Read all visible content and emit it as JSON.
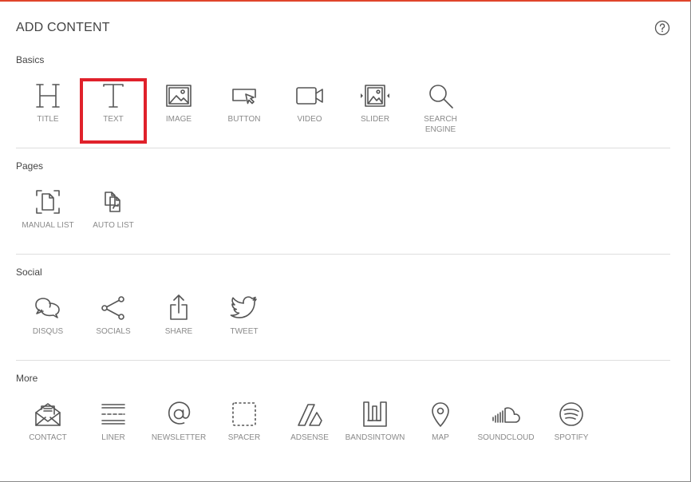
{
  "header": {
    "title": "ADD CONTENT"
  },
  "sections": [
    {
      "label": "Basics",
      "items": [
        {
          "label": "TITLE",
          "icon": "title-heading-icon"
        },
        {
          "label": "TEXT",
          "icon": "text-t-icon"
        },
        {
          "label": "IMAGE",
          "icon": "image-icon"
        },
        {
          "label": "BUTTON",
          "icon": "button-cursor-icon"
        },
        {
          "label": "VIDEO",
          "icon": "video-camera-icon"
        },
        {
          "label": "SLIDER",
          "icon": "slider-image-icon"
        },
        {
          "label": "SEARCH ENGINE",
          "icon": "magnifier-icon"
        }
      ]
    },
    {
      "label": "Pages",
      "items": [
        {
          "label": "MANUAL LIST",
          "icon": "manual-list-page-icon"
        },
        {
          "label": "AUTO LIST",
          "icon": "auto-list-pages-icon"
        }
      ]
    },
    {
      "label": "Social",
      "items": [
        {
          "label": "DISQUS",
          "icon": "speech-bubbles-icon"
        },
        {
          "label": "SOCIALS",
          "icon": "share-nodes-icon"
        },
        {
          "label": "SHARE",
          "icon": "share-upload-icon"
        },
        {
          "label": "TWEET",
          "icon": "twitter-bird-icon"
        }
      ]
    },
    {
      "label": "More",
      "items": [
        {
          "label": "CONTACT",
          "icon": "envelope-icon"
        },
        {
          "label": "LINER",
          "icon": "divider-lines-icon"
        },
        {
          "label": "NEWSLETTER",
          "icon": "at-sign-icon"
        },
        {
          "label": "SPACER",
          "icon": "dashed-square-icon"
        },
        {
          "label": "ADSENSE",
          "icon": "adsense-icon"
        },
        {
          "label": "BANDSINTOWN",
          "icon": "bandsintown-icon"
        },
        {
          "label": "MAP",
          "icon": "map-pin-icon"
        },
        {
          "label": "SOUNDCLOUD",
          "icon": "soundcloud-icon"
        },
        {
          "label": "SPOTIFY",
          "icon": "spotify-icon"
        }
      ]
    }
  ],
  "selected": "TEXT",
  "colors": {
    "accent": "#e0452b",
    "selection": "#e0212b",
    "label": "#8a8a8a"
  }
}
